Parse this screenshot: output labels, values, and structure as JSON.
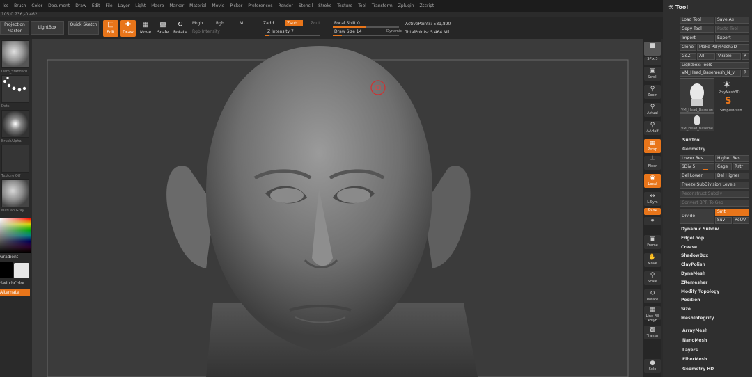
{
  "menu": [
    "lcs",
    "Brush",
    "Color",
    "Document",
    "Draw",
    "Edit",
    "File",
    "Layer",
    "Light",
    "Macro",
    "Marker",
    "Material",
    "Movie",
    "Picker",
    "Preferences",
    "Render",
    "Stencil",
    "Stroke",
    "Texture",
    "Tool",
    "Transform",
    "Zplugin",
    "Zscript"
  ],
  "coords": ".105,0.736,-0.462",
  "toolbar": {
    "projection_master": "Projection Master",
    "lightbox": "LightBox",
    "quick_sketch": "Quick Sketch",
    "edit": "Edit",
    "draw": "Draw",
    "move": "Move",
    "scale": "Scale",
    "rotate": "Rotate",
    "mrgb": "Mrgb",
    "rgb": "Rgb",
    "m": "M",
    "rgb_intensity": "Rgb Intensity",
    "zadd": "Zadd",
    "zsub": "Zsub",
    "zcut": "Zcut",
    "z_intensity": "Z Intensity 7",
    "focal_shift": "Focal Shift 0",
    "draw_size": "Draw Size 14",
    "dynamic": "Dynamic",
    "active_points": "ActivePoints: 581,890",
    "total_points": "TotalPoints: 5.464 Mil",
    "z_intensity_level": 0.07,
    "focal_shift_level": 0.5,
    "draw_size_level": 0.14
  },
  "left_tray": {
    "brush": "Dam_Standard",
    "stroke": "Dots",
    "alpha": "BrushAlpha",
    "texture": "Texture Off",
    "material": "MatCap Gray",
    "gradient": "Gradient",
    "switch_color": "SwitchColor",
    "alternate": "Alternate"
  },
  "right_shelf": {
    "bpr": "BPR",
    "spix": "SPix 3",
    "scroll": "Scroll",
    "zoom": "Zoom",
    "actual": "Actual",
    "aahalf": "AAHalf",
    "persp": "Persp",
    "floor": "Floor",
    "local": "Local",
    "lsym": "L.Sym",
    "qxyz": "Qxyz",
    "frame": "Frame",
    "move": "Move",
    "scale": "Scale",
    "rotate": "Rotate",
    "line_fill": "Line Fill PolyF",
    "transp": "Transp",
    "solo": "Solo"
  },
  "tool_palette": {
    "title": "Tool",
    "load_tool": "Load Tool",
    "save_as": "Save As",
    "copy_tool": "Copy Tool",
    "paste_tool": "Paste Tool",
    "import": "Import",
    "export": "Export",
    "clone": "Clone",
    "make_polymesh": "Make PolyMesh3D",
    "goz": "GoZ",
    "all": "All",
    "visible": "Visible",
    "r": "R",
    "lightbox_tools": "Lightbox▸Tools",
    "current_tool": "VM_Head_Basemesh_N_v",
    "thumb_head": "VM_Head_Baseme",
    "thumb_polymesh": "PolyMesh3D",
    "thumb_simplebrush": "SimpleBrush",
    "thumb_head_small": "VM_Head_Baseme",
    "subtool": "SubTool",
    "geometry": "Geometry",
    "lower_res": "Lower Res",
    "higher_res": "Higher Res",
    "sdiv": "SDiv 5",
    "cage": "Cage",
    "rstr": "Rstr",
    "del_lower": "Del Lower",
    "del_higher": "Del Higher",
    "freeze_subdiv": "Freeze SubDivision Levels",
    "reconstruct": "Reconstruct Subdiv",
    "convert_bpr": "Convert BPR To Geo",
    "divide": "Divide",
    "smt": "Smt",
    "suv": "Suv",
    "reuv": "ReUV",
    "items": [
      "Dynamic Subdiv",
      "EdgeLoop",
      "Crease",
      "ShadowBox",
      "ClayPolish",
      "DynaMesh",
      "ZRemesher",
      "Modify Topology",
      "Position",
      "Size",
      "MeshIntegrity"
    ],
    "bottom_items": [
      "ArrayMesh",
      "NanoMesh",
      "Layers",
      "FiberMesh",
      "Geometry HD"
    ]
  },
  "colors": {
    "accent": "#e8751a",
    "panel": "#2f2f2f",
    "canvas": "#3b3b3b"
  }
}
